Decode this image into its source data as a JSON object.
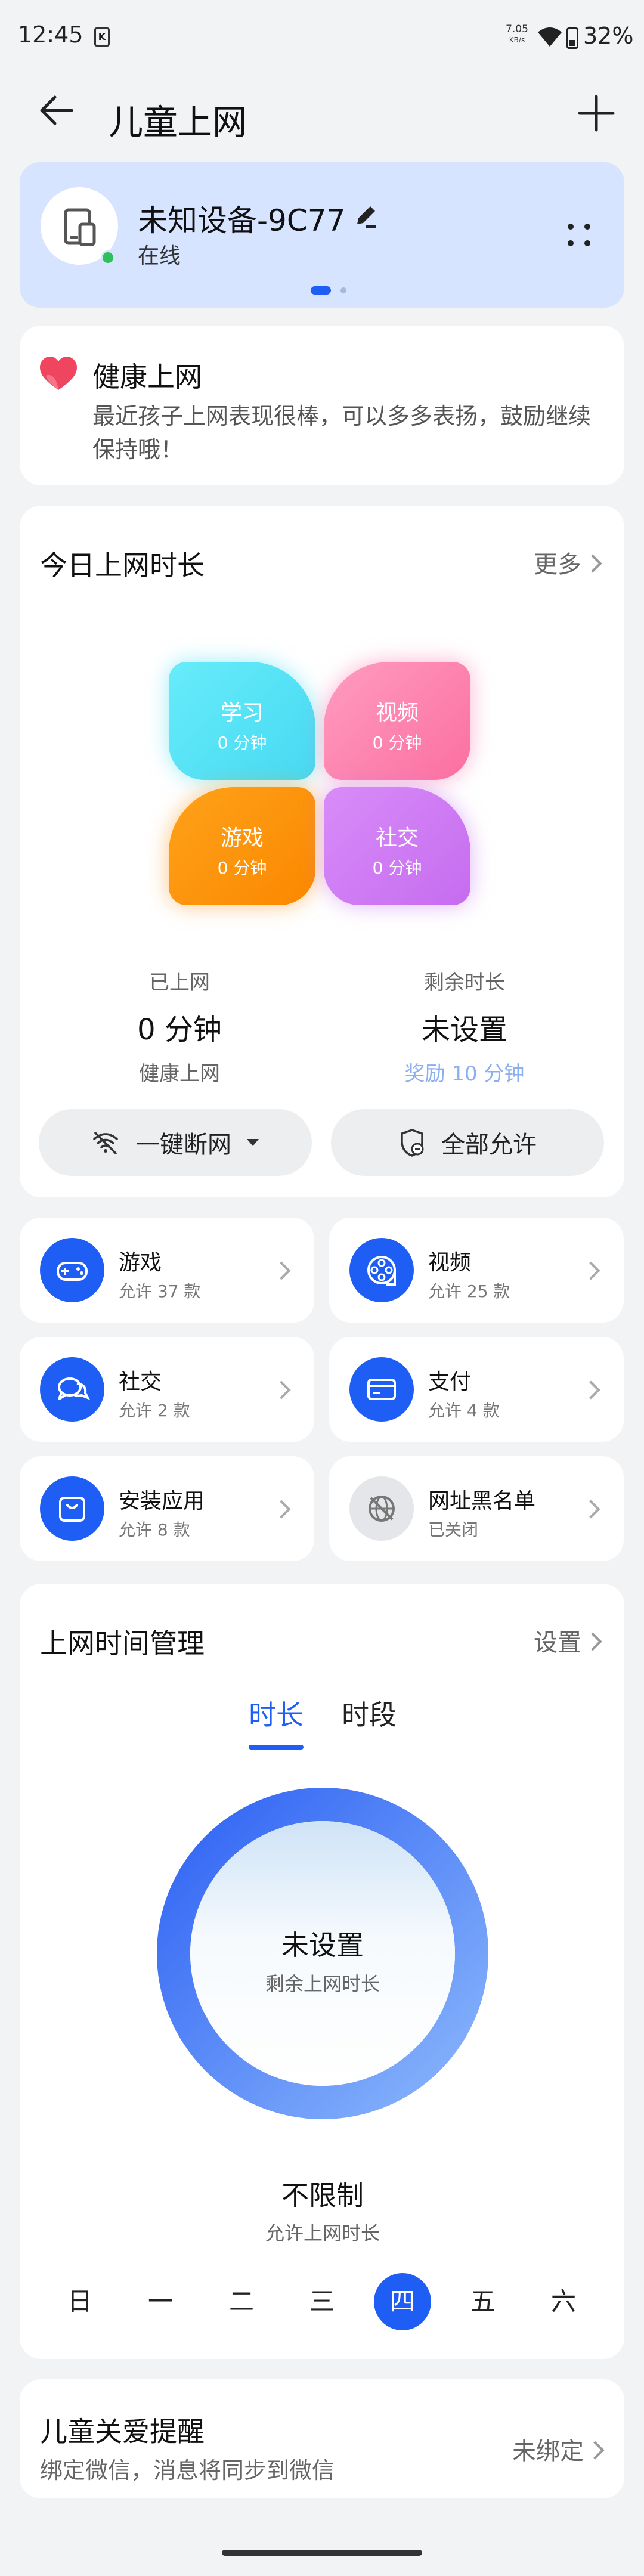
{
  "status_bar": {
    "time": "12:45",
    "net_speed_value": "7.05",
    "net_speed_unit": "KB/s",
    "battery": "32%"
  },
  "header": {
    "title": "儿童上网"
  },
  "device": {
    "name": "未知设备-9C77",
    "status": "在线",
    "pager_total": 2,
    "pager_active": 0
  },
  "health": {
    "title": "健康上网",
    "description": "最近孩子上网表现很棒，可以多多表扬，鼓励继续保持哦！"
  },
  "today": {
    "title": "今日上网时长",
    "more": "更多",
    "categories": [
      {
        "name": "学习",
        "value": "0 分钟",
        "color": "#4fe0f5"
      },
      {
        "name": "视频",
        "value": "0 分钟",
        "color": "#fc80ad"
      },
      {
        "name": "游戏",
        "value": "0 分钟",
        "color": "#fb9410"
      },
      {
        "name": "社交",
        "value": "0 分钟",
        "color": "#cf7bf4"
      }
    ],
    "used_label": "已上网",
    "used_value": "0 分钟",
    "used_sub": "健康上网",
    "remaining_label": "剩余时长",
    "remaining_value": "未设置",
    "remaining_sub": "奖励 10 分钟",
    "disconnect_btn": "一键断网",
    "allow_all_btn": "全部允许"
  },
  "features": [
    {
      "name": "游戏",
      "sub": "允许 37 款",
      "icon": "gamepad-icon"
    },
    {
      "name": "视频",
      "sub": "允许 25 款",
      "icon": "film-reel-icon"
    },
    {
      "name": "社交",
      "sub": "允许 2 款",
      "icon": "chat-icon"
    },
    {
      "name": "支付",
      "sub": "允许 4 款",
      "icon": "card-icon"
    },
    {
      "name": "安装应用",
      "sub": "允许 8 款",
      "icon": "bag-icon"
    },
    {
      "name": "网址黑名单",
      "sub": "已关闭",
      "icon": "globe-blocked-icon"
    }
  ],
  "time_mgmt": {
    "title": "上网时间管理",
    "setting": "设置",
    "tabs": [
      "时长",
      "时段"
    ],
    "active_tab": 0,
    "ring_title": "未设置",
    "ring_sub": "剩余上网时长",
    "limit_title": "不限制",
    "limit_sub": "允许上网时长",
    "days": [
      "日",
      "一",
      "二",
      "三",
      "四",
      "五",
      "六"
    ],
    "active_day": 4
  },
  "care": {
    "title": "儿童关爱提醒",
    "sub": "绑定微信，消息将同步到微信",
    "status": "未绑定"
  },
  "colors": {
    "accent": "#1f5ef5",
    "device_card_bg": "#d6e4ff",
    "online": "#2ec15a",
    "page_bg": "#f1f3f5"
  }
}
